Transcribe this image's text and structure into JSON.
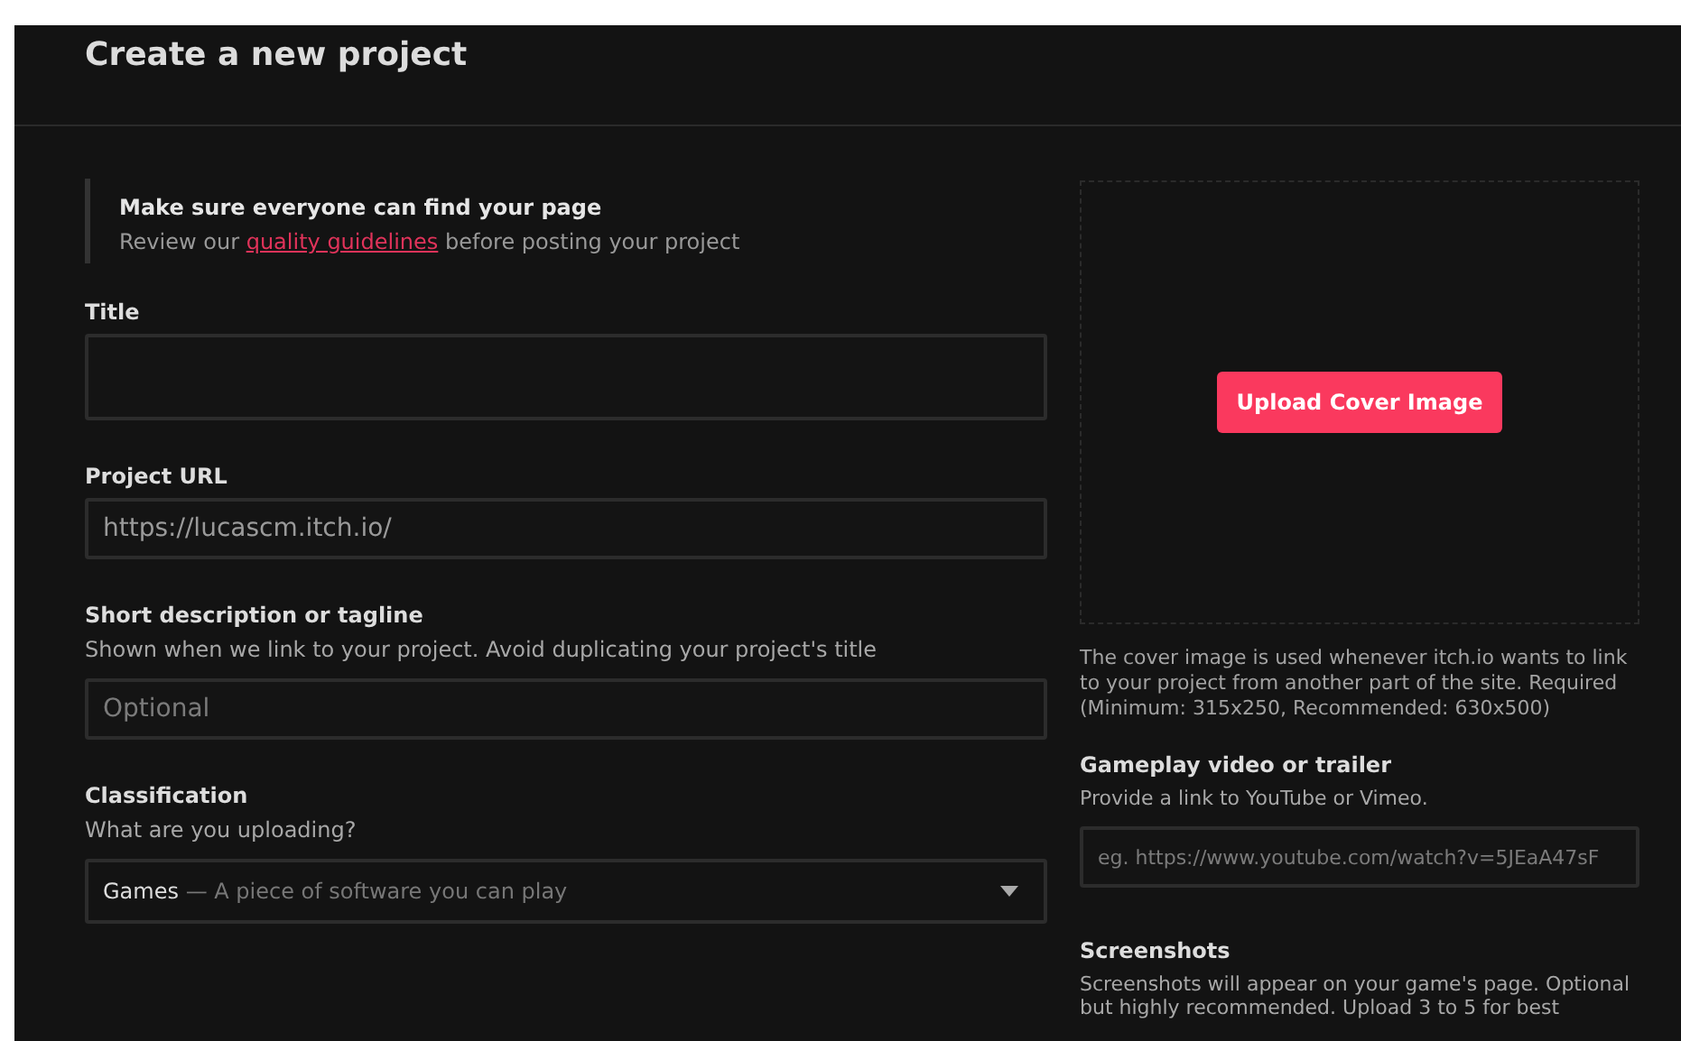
{
  "header": {
    "title": "Create a new project"
  },
  "notice": {
    "heading": "Make sure everyone can find your page",
    "text_before": "Review our",
    "link": "quality guidelines",
    "text_after": "before posting your project"
  },
  "fields": [
    {
      "kind": "input",
      "label": "Title"
    },
    {
      "kind": "input",
      "label": "Project URL",
      "value": "https://lucascm.itch.io/"
    },
    {
      "kind": "input",
      "label": "Short description or tagline",
      "hint": "Shown when we link to your project. Avoid duplicating your project's title",
      "placeholder": "Optional"
    },
    {
      "kind": "select",
      "label": "Classification",
      "hint": "What are you uploading?",
      "value": "Games",
      "value_detail": "— A piece of software you can play"
    }
  ],
  "cover": {
    "button": "Upload Cover Image",
    "note": "The cover image is used whenever itch.io wants to link to your project from another part of the site. Required (Minimum: 315x250, Recommended: 630x500)"
  },
  "side_fields": [
    {
      "kind": "input",
      "label": "Gameplay video or trailer",
      "hint": "Provide a link to YouTube or Vimeo.",
      "placeholder": "eg. https://www.youtube.com/watch?v=5JEaA47sF"
    },
    {
      "kind": "text",
      "label": "Screenshots",
      "hint": "Screenshots will appear on your game's page. Optional but highly recommended. Upload 3 to 5 for best"
    }
  ]
}
